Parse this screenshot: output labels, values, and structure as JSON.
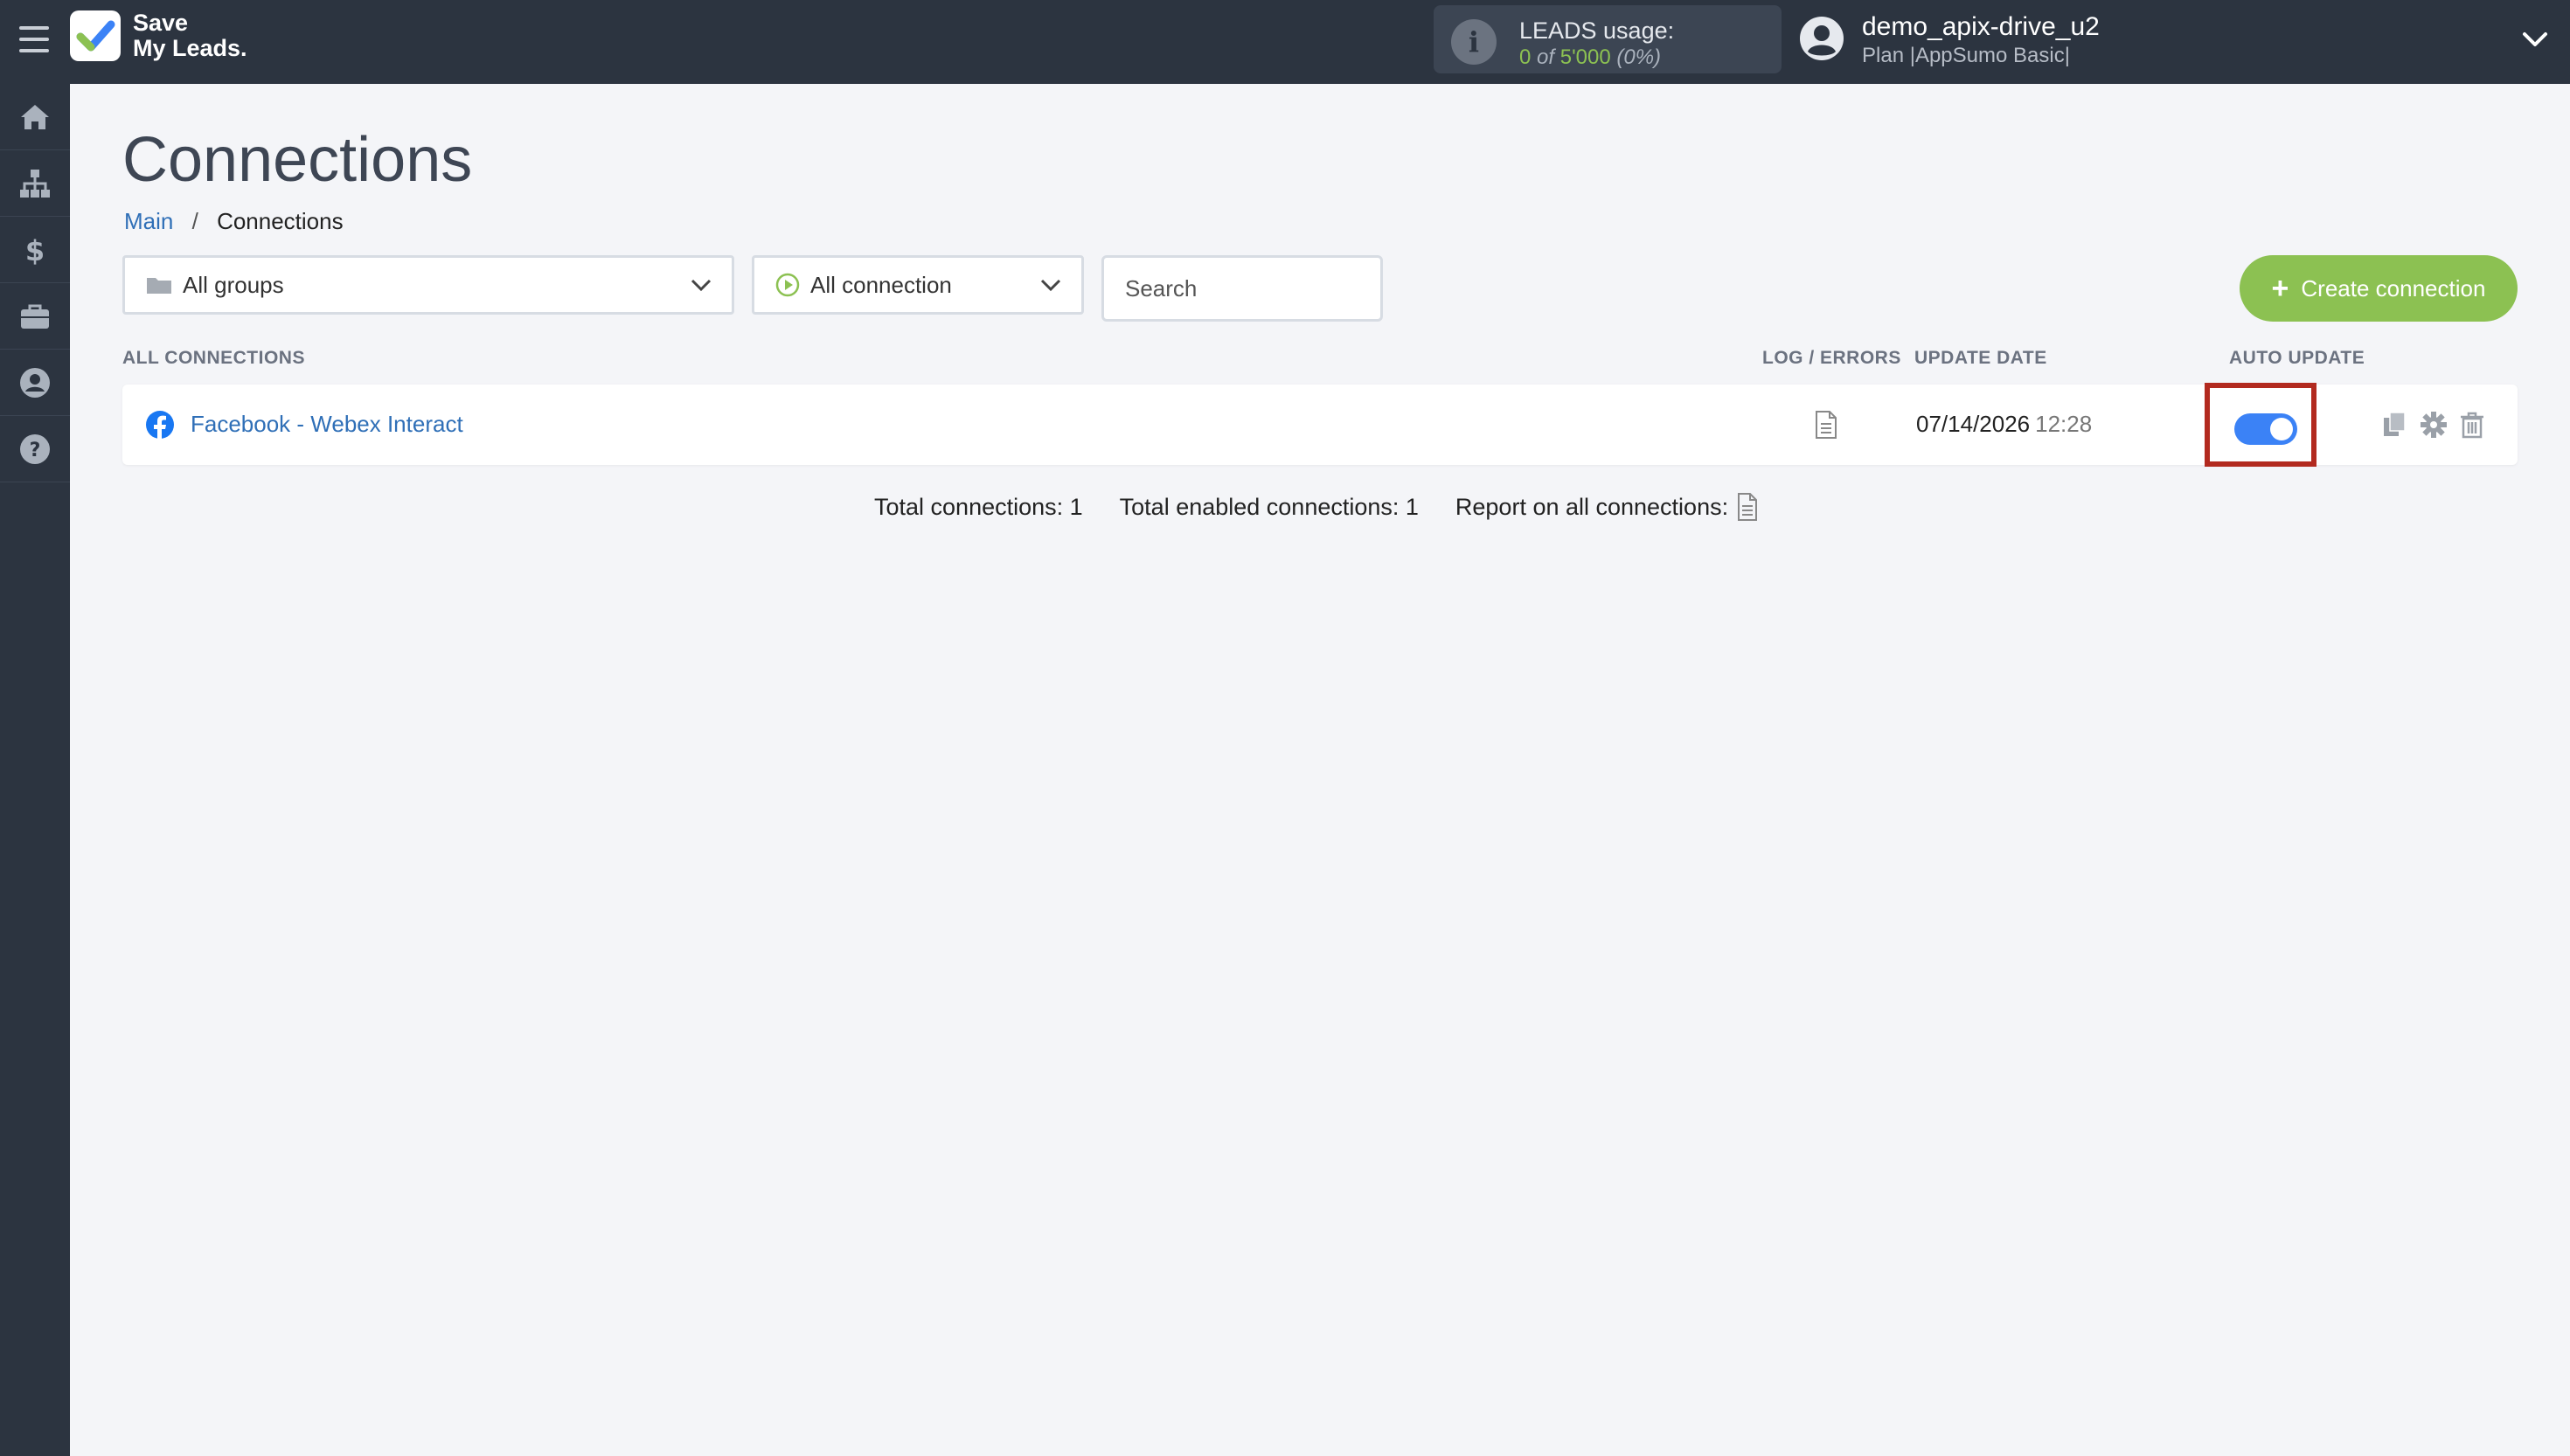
{
  "brand": {
    "line1": "Save",
    "line2": "My Leads."
  },
  "leads": {
    "label": "LEADS usage:",
    "used": "0",
    "of": "of",
    "total": "5'000",
    "percent": "(0%)"
  },
  "user": {
    "name": "demo_apix-drive_u2",
    "plan": "Plan |AppSumo Basic|"
  },
  "sidebar": {
    "items": [
      {
        "icon": "home-icon"
      },
      {
        "icon": "sitemap-icon"
      },
      {
        "icon": "dollar-icon"
      },
      {
        "icon": "briefcase-icon"
      },
      {
        "icon": "user-circle-icon"
      },
      {
        "icon": "help-icon"
      }
    ]
  },
  "page": {
    "title": "Connections"
  },
  "breadcrumb": {
    "home": "Main",
    "separator": "/",
    "current": "Connections"
  },
  "filters": {
    "groups": "All groups",
    "connection": "All connection",
    "search_placeholder": "Search",
    "create_label": "Create connection"
  },
  "columns": {
    "all": "ALL CONNECTIONS",
    "log": "LOG / ERRORS",
    "date": "UPDATE DATE",
    "auto": "AUTO UPDATE"
  },
  "connections": [
    {
      "name": "Facebook - Webex Interact",
      "date": "07/14/2026",
      "time": "12:28",
      "auto_update": true
    }
  ],
  "totals": {
    "total": "Total connections: 1",
    "enabled": "Total enabled connections: 1",
    "report": "Report on all connections:"
  },
  "colors": {
    "topbar": "#2c3440",
    "accent_green": "#8cc152",
    "link_blue": "#2f6fb7",
    "toggle_on": "#3b82f6",
    "highlight": "#b22a1f"
  }
}
